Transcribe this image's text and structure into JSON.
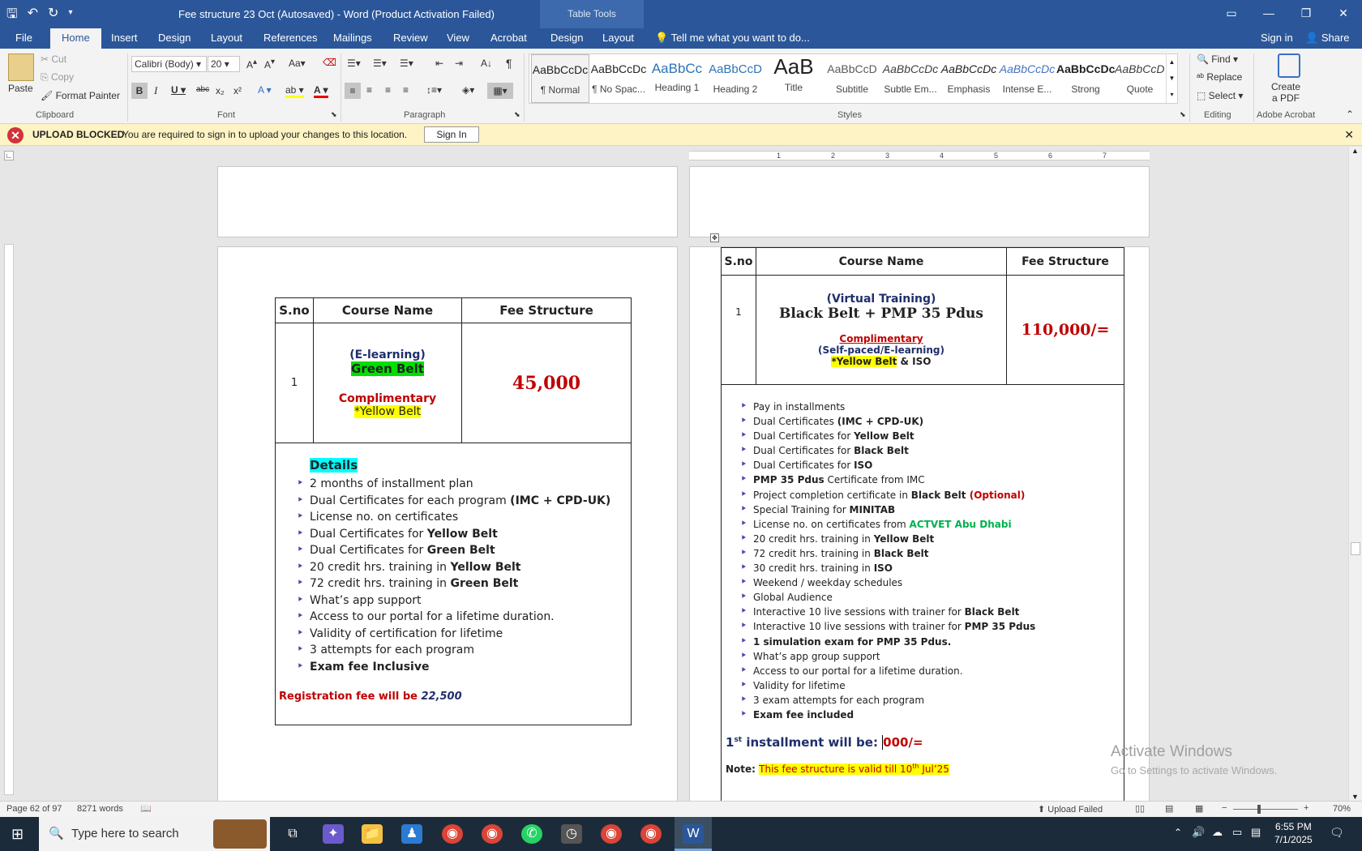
{
  "titlebar": {
    "title": "Fee structure 23 Oct (Autosaved) - Word (Product Activation Failed)",
    "table_tools": "Table Tools"
  },
  "tabs": {
    "file": "File",
    "home": "Home",
    "insert": "Insert",
    "design": "Design",
    "layout": "Layout",
    "references": "References",
    "mailings": "Mailings",
    "review": "Review",
    "view": "View",
    "acrobat": "Acrobat",
    "tt_design": "Design",
    "tt_layout": "Layout",
    "tell_me": "Tell me what you want to do...",
    "sign_in": "Sign in",
    "share": "Share"
  },
  "clipboard": {
    "paste": "Paste",
    "cut": "Cut",
    "copy": "Copy",
    "format_painter": "Format Painter",
    "label": "Clipboard"
  },
  "font": {
    "name": "Calibri (Body)",
    "size": "20",
    "label": "Font"
  },
  "paragraph": {
    "label": "Paragraph"
  },
  "styles": {
    "label": "Styles",
    "items": [
      {
        "preview": "AaBbCcDc",
        "name": "¶ Normal"
      },
      {
        "preview": "AaBbCcDc",
        "name": "¶ No Spac..."
      },
      {
        "preview": "AaBbCc",
        "name": "Heading 1"
      },
      {
        "preview": "AaBbCcD",
        "name": "Heading 2"
      },
      {
        "preview": "AaB",
        "name": "Title"
      },
      {
        "preview": "AaBbCcD",
        "name": "Subtitle"
      },
      {
        "preview": "AaBbCcDc",
        "name": "Subtle Em..."
      },
      {
        "preview": "AaBbCcDc",
        "name": "Emphasis"
      },
      {
        "preview": "AaBbCcDc",
        "name": "Intense E..."
      },
      {
        "preview": "AaBbCcDc",
        "name": "Strong"
      },
      {
        "preview": "AaBbCcDc",
        "name": "Quote"
      }
    ]
  },
  "editing": {
    "find": "Find",
    "replace": "Replace",
    "select": "Select",
    "label": "Editing"
  },
  "acrobat": {
    "create_pdf_1": "Create",
    "create_pdf_2": "a PDF",
    "label": "Adobe Acrobat"
  },
  "message": {
    "title": "UPLOAD BLOCKED",
    "text": "You are required to sign in to upload your changes to this location.",
    "button": "Sign In"
  },
  "left_page": {
    "headers": [
      "S.no",
      "Course Name",
      "Fee Structure"
    ],
    "sno": "1",
    "mode": "(E-learning)",
    "course": "Green Belt",
    "comp": "Complimentary",
    "comp_item": "*Yellow Belt",
    "fee": "45,000",
    "details_title": "Details",
    "items": [
      [
        "2 months of installment plan",
        ""
      ],
      [
        "Dual Certificates for each program ",
        "(IMC + CPD-UK)"
      ],
      [
        "License no. on certificates",
        ""
      ],
      [
        "Dual Certificates for ",
        "Yellow Belt"
      ],
      [
        "Dual Certificates for ",
        "Green Belt"
      ],
      [
        "20 credit hrs. training in ",
        "Yellow Belt"
      ],
      [
        "72 credit hrs. training in ",
        "Green Belt"
      ],
      [
        "What’s app support",
        ""
      ],
      [
        "Access to our portal for a lifetime duration.",
        ""
      ],
      [
        "Validity of certification for lifetime",
        ""
      ],
      [
        "3 attempts for each program",
        ""
      ],
      [
        "",
        "Exam fee Inclusive"
      ]
    ],
    "reg_text": "Registration fee will be ",
    "reg_amount": "22,500"
  },
  "right_page": {
    "headers": [
      "S.no",
      "Course Name",
      "Fee Structure"
    ],
    "sno": "1",
    "mode": "(Virtual Training)",
    "course": "Black Belt + PMP 35 Pdus",
    "comp": "Complimentary",
    "comp_mode": "(Self-paced/E-learning)",
    "comp_item": "*Yellow Belt",
    "comp_rest": " & ISO",
    "fee": "110,000/=",
    "items": [
      {
        "pre": "Pay in installments",
        "bold": "",
        "post": "",
        "postcls": ""
      },
      {
        "pre": "Dual Certificates ",
        "bold": "(IMC + CPD-UK)",
        "post": "",
        "postcls": ""
      },
      {
        "pre": "Dual Certificates for ",
        "bold": "Yellow Belt",
        "post": "",
        "postcls": ""
      },
      {
        "pre": "Dual Certificates for ",
        "bold": "Black Belt",
        "post": "",
        "postcls": ""
      },
      {
        "pre": " Dual Certificates for ",
        "bold": "ISO",
        "post": "",
        "postcls": ""
      },
      {
        "pre": "",
        "bold": "PMP 35 Pdus",
        "post": " Certificate from IMC",
        "postcls": ""
      },
      {
        "pre": "Project completion certificate in ",
        "bold": "Black Belt",
        "post": " (Optional)",
        "postcls": "red b"
      },
      {
        "pre": "Special Training for ",
        "bold": "MINITAB",
        "post": "",
        "postcls": ""
      },
      {
        "pre": "License no. on certificates from ",
        "bold": "",
        "post": "ACTVET Abu Dhabi",
        "postcls": "green"
      },
      {
        "pre": "20 credit hrs. training in ",
        "bold": "Yellow Belt",
        "post": "",
        "postcls": ""
      },
      {
        "pre": "72 credit hrs. training in ",
        "bold": "Black Belt",
        "post": "",
        "postcls": ""
      },
      {
        "pre": "30 credit hrs. training in ",
        "bold": "ISO",
        "post": "",
        "postcls": ""
      },
      {
        "pre": "Weekend / weekday schedules",
        "bold": "",
        "post": "",
        "postcls": ""
      },
      {
        "pre": "Global Audience",
        "bold": "",
        "post": "",
        "postcls": ""
      },
      {
        "pre": "Interactive 10 live sessions with trainer for ",
        "bold": "Black Belt",
        "post": "",
        "postcls": ""
      },
      {
        "pre": "Interactive 10 live sessions with trainer for ",
        "bold": "PMP 35 Pdus",
        "post": "",
        "postcls": ""
      },
      {
        "pre": "",
        "bold": "1 simulation exam for PMP 35 Pdus.",
        "post": "",
        "postcls": ""
      },
      {
        "pre": "What’s app group support",
        "bold": "",
        "post": "",
        "postcls": ""
      },
      {
        "pre": "Access to our portal for a lifetime duration.",
        "bold": "",
        "post": "",
        "postcls": ""
      },
      {
        "pre": "Validity for lifetime",
        "bold": "",
        "post": "",
        "postcls": ""
      },
      {
        "pre": "3 exam attempts for each program",
        "bold": "",
        "post": "",
        "postcls": ""
      },
      {
        "pre": "",
        "bold": "Exam fee included",
        "post": "",
        "postcls": ""
      }
    ],
    "installment_pre": "1",
    "installment_sup": "st",
    "installment_text": " installment will be: ",
    "installment_amount": "000/=",
    "note_label": "Note: ",
    "note_text": "This fee structure is valid till 10",
    "note_sup": "th",
    "note_end": " Jul’25"
  },
  "ruler_numbers": [
    "1",
    "2",
    "3",
    "4",
    "5",
    "6",
    "7"
  ],
  "watermark": {
    "line1": "Activate Windows",
    "line2": "Go to Settings to activate Windows."
  },
  "status": {
    "page": "Page 62 of 97",
    "words": "8271 words",
    "upload": "Upload Failed",
    "zoom": "70%"
  },
  "taskbar": {
    "search": "Type here to search",
    "time": "6:55 PM",
    "date": "7/1/2025"
  },
  "colors": {
    "word_blue": "#2b579a",
    "red": "#c00000",
    "navy": "#1f2f6b"
  }
}
